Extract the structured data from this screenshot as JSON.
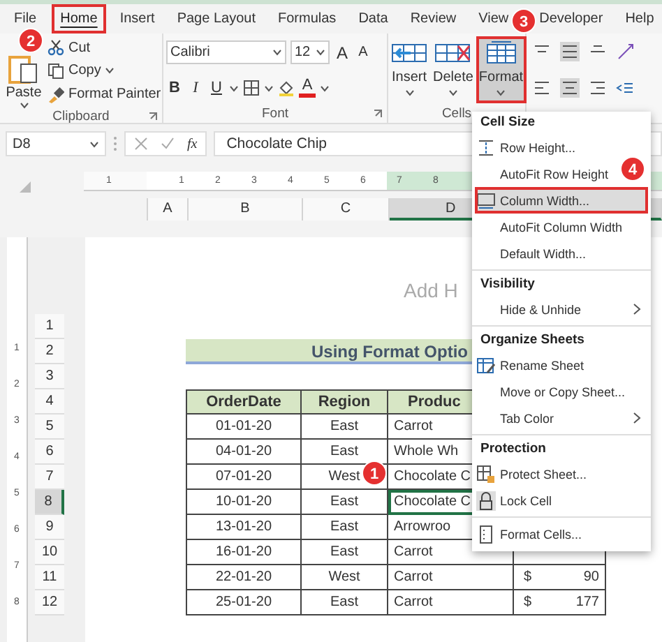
{
  "tabs": [
    {
      "label": "File",
      "selected": false
    },
    {
      "label": "Home",
      "selected": true,
      "callout": "2"
    },
    {
      "label": "Insert",
      "selected": false
    },
    {
      "label": "Page Layout",
      "selected": false
    },
    {
      "label": "Formulas",
      "selected": false
    },
    {
      "label": "Data",
      "selected": false
    },
    {
      "label": "Review",
      "selected": false
    },
    {
      "label": "View",
      "selected": false
    },
    {
      "label": "Developer",
      "selected": false
    },
    {
      "label": "Help",
      "selected": false
    }
  ],
  "clipboard": {
    "paste": "Paste",
    "group_label": "Clipboard",
    "items": [
      {
        "label": "Cut",
        "dropdown": false
      },
      {
        "label": "Copy",
        "dropdown": true
      },
      {
        "label": "Format Painter",
        "dropdown": false
      }
    ]
  },
  "font": {
    "font_name": "Calibri",
    "font_size": "12",
    "grow": "A",
    "shrink": "A",
    "bold": "B",
    "italic": "I",
    "underline": "U",
    "font_color": "A",
    "group_label": "Font"
  },
  "cells": {
    "group_label": "Cells",
    "buttons": [
      {
        "label": "Insert",
        "selected": false
      },
      {
        "label": "Delete",
        "selected": false
      },
      {
        "label": "Format",
        "selected": true,
        "callout": "3"
      }
    ]
  },
  "formula_bar": {
    "name_box": "D8",
    "function_label": "fx",
    "formula": "Chocolate Chip"
  },
  "ruler": {
    "horizontal": [
      "1",
      "1",
      "2",
      "3",
      "4",
      "5",
      "6",
      "7",
      "8"
    ],
    "vertical": [
      "1",
      "2",
      "3",
      "4",
      "5",
      "6",
      "7",
      "8"
    ]
  },
  "columns": [
    {
      "label": "A",
      "selected": false
    },
    {
      "label": "B",
      "selected": false
    },
    {
      "label": "C",
      "selected": false
    },
    {
      "label": "D",
      "selected": true
    }
  ],
  "row_headers": [
    {
      "label": "1",
      "selected": false
    },
    {
      "label": "2",
      "selected": false
    },
    {
      "label": "3",
      "selected": false
    },
    {
      "label": "4",
      "selected": false
    },
    {
      "label": "5",
      "selected": false
    },
    {
      "label": "6",
      "selected": false
    },
    {
      "label": "7",
      "selected": false
    },
    {
      "label": "8",
      "selected": true
    },
    {
      "label": "9",
      "selected": false
    },
    {
      "label": "10",
      "selected": false
    },
    {
      "label": "11",
      "selected": false
    },
    {
      "label": "12",
      "selected": false
    }
  ],
  "page_header": "Add H",
  "sheet_title": "Using Format Optio",
  "table": {
    "columns": [
      "OrderDate",
      "Region",
      "Produc"
    ],
    "rows": [
      {
        "order_date": "01-01-20",
        "region": "East",
        "product": {
          "text": "Carrot",
          "selected": false
        }
      },
      {
        "order_date": "04-01-20",
        "region": "East",
        "product": {
          "text": "Whole Wh",
          "selected": false
        }
      },
      {
        "order_date": "07-01-20",
        "region": "West",
        "product": {
          "text": "Chocolate C",
          "selected": false
        },
        "callout": "1"
      },
      {
        "order_date": "10-01-20",
        "region": "East",
        "product": {
          "text": "Chocolate C",
          "selected": true
        }
      },
      {
        "order_date": "13-01-20",
        "region": "East",
        "product": {
          "text": "Arrowroo",
          "selected": false
        }
      },
      {
        "order_date": "16-01-20",
        "region": "East",
        "product": {
          "text": "Carrot",
          "selected": false
        }
      },
      {
        "order_date": "22-01-20",
        "region": "West",
        "product": {
          "text": "Carrot",
          "selected": false
        },
        "sales": {
          "currency": "$",
          "amount": "90"
        }
      },
      {
        "order_date": "25-01-20",
        "region": "East",
        "product": {
          "text": "Carrot",
          "selected": false
        },
        "sales": {
          "currency": "$",
          "amount": "177"
        }
      }
    ]
  },
  "format_menu": {
    "sections": [
      {
        "heading": "Cell Size",
        "items": [
          {
            "label": "Row Height...",
            "submenu": false,
            "selected": false
          },
          {
            "label": "AutoFit Row Height",
            "submenu": false,
            "selected": false
          },
          {
            "label": "Column Width...",
            "submenu": false,
            "selected": true,
            "callout": "4"
          },
          {
            "label": "AutoFit Column Width",
            "submenu": false,
            "selected": false
          },
          {
            "label": "Default Width...",
            "submenu": false,
            "selected": false
          }
        ]
      },
      {
        "heading": "Visibility",
        "items": [
          {
            "label": "Hide & Unhide",
            "submenu": true,
            "selected": false
          }
        ]
      },
      {
        "heading": "Organize Sheets",
        "items": [
          {
            "label": "Rename Sheet",
            "submenu": false,
            "selected": false
          },
          {
            "label": "Move or Copy Sheet...",
            "submenu": false,
            "selected": false
          },
          {
            "label": "Tab Color",
            "submenu": true,
            "selected": false
          }
        ]
      },
      {
        "heading": "Protection",
        "items": [
          {
            "label": "Protect Sheet...",
            "submenu": false,
            "selected": false
          },
          {
            "label": "Lock Cell",
            "submenu": false,
            "selected": false
          },
          {
            "label": "Format Cells...",
            "submenu": false,
            "selected": false,
            "divider_before": true
          }
        ]
      }
    ]
  }
}
